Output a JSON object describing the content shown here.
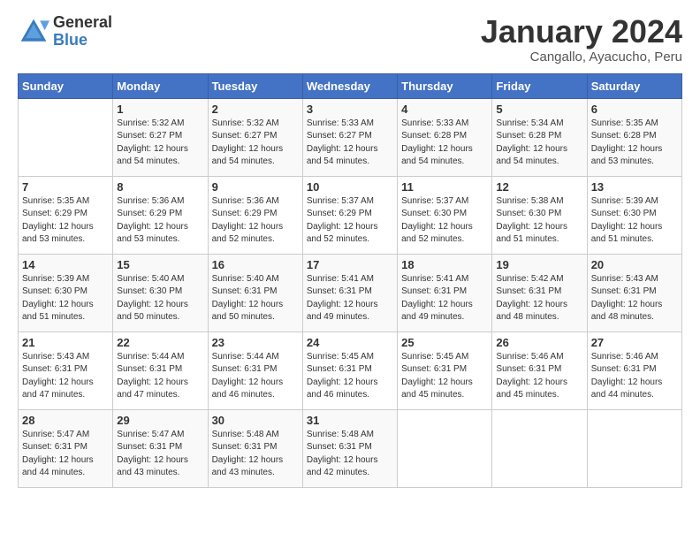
{
  "header": {
    "logo_general": "General",
    "logo_blue": "Blue",
    "month_title": "January 2024",
    "subtitle": "Cangallo, Ayacucho, Peru"
  },
  "days_of_week": [
    "Sunday",
    "Monday",
    "Tuesday",
    "Wednesday",
    "Thursday",
    "Friday",
    "Saturday"
  ],
  "weeks": [
    [
      {
        "day": "",
        "info": ""
      },
      {
        "day": "1",
        "info": "Sunrise: 5:32 AM\nSunset: 6:27 PM\nDaylight: 12 hours\nand 54 minutes."
      },
      {
        "day": "2",
        "info": "Sunrise: 5:32 AM\nSunset: 6:27 PM\nDaylight: 12 hours\nand 54 minutes."
      },
      {
        "day": "3",
        "info": "Sunrise: 5:33 AM\nSunset: 6:27 PM\nDaylight: 12 hours\nand 54 minutes."
      },
      {
        "day": "4",
        "info": "Sunrise: 5:33 AM\nSunset: 6:28 PM\nDaylight: 12 hours\nand 54 minutes."
      },
      {
        "day": "5",
        "info": "Sunrise: 5:34 AM\nSunset: 6:28 PM\nDaylight: 12 hours\nand 54 minutes."
      },
      {
        "day": "6",
        "info": "Sunrise: 5:35 AM\nSunset: 6:28 PM\nDaylight: 12 hours\nand 53 minutes."
      }
    ],
    [
      {
        "day": "7",
        "info": "Sunrise: 5:35 AM\nSunset: 6:29 PM\nDaylight: 12 hours\nand 53 minutes."
      },
      {
        "day": "8",
        "info": "Sunrise: 5:36 AM\nSunset: 6:29 PM\nDaylight: 12 hours\nand 53 minutes."
      },
      {
        "day": "9",
        "info": "Sunrise: 5:36 AM\nSunset: 6:29 PM\nDaylight: 12 hours\nand 52 minutes."
      },
      {
        "day": "10",
        "info": "Sunrise: 5:37 AM\nSunset: 6:29 PM\nDaylight: 12 hours\nand 52 minutes."
      },
      {
        "day": "11",
        "info": "Sunrise: 5:37 AM\nSunset: 6:30 PM\nDaylight: 12 hours\nand 52 minutes."
      },
      {
        "day": "12",
        "info": "Sunrise: 5:38 AM\nSunset: 6:30 PM\nDaylight: 12 hours\nand 51 minutes."
      },
      {
        "day": "13",
        "info": "Sunrise: 5:39 AM\nSunset: 6:30 PM\nDaylight: 12 hours\nand 51 minutes."
      }
    ],
    [
      {
        "day": "14",
        "info": "Sunrise: 5:39 AM\nSunset: 6:30 PM\nDaylight: 12 hours\nand 51 minutes."
      },
      {
        "day": "15",
        "info": "Sunrise: 5:40 AM\nSunset: 6:30 PM\nDaylight: 12 hours\nand 50 minutes."
      },
      {
        "day": "16",
        "info": "Sunrise: 5:40 AM\nSunset: 6:31 PM\nDaylight: 12 hours\nand 50 minutes."
      },
      {
        "day": "17",
        "info": "Sunrise: 5:41 AM\nSunset: 6:31 PM\nDaylight: 12 hours\nand 49 minutes."
      },
      {
        "day": "18",
        "info": "Sunrise: 5:41 AM\nSunset: 6:31 PM\nDaylight: 12 hours\nand 49 minutes."
      },
      {
        "day": "19",
        "info": "Sunrise: 5:42 AM\nSunset: 6:31 PM\nDaylight: 12 hours\nand 48 minutes."
      },
      {
        "day": "20",
        "info": "Sunrise: 5:43 AM\nSunset: 6:31 PM\nDaylight: 12 hours\nand 48 minutes."
      }
    ],
    [
      {
        "day": "21",
        "info": "Sunrise: 5:43 AM\nSunset: 6:31 PM\nDaylight: 12 hours\nand 47 minutes."
      },
      {
        "day": "22",
        "info": "Sunrise: 5:44 AM\nSunset: 6:31 PM\nDaylight: 12 hours\nand 47 minutes."
      },
      {
        "day": "23",
        "info": "Sunrise: 5:44 AM\nSunset: 6:31 PM\nDaylight: 12 hours\nand 46 minutes."
      },
      {
        "day": "24",
        "info": "Sunrise: 5:45 AM\nSunset: 6:31 PM\nDaylight: 12 hours\nand 46 minutes."
      },
      {
        "day": "25",
        "info": "Sunrise: 5:45 AM\nSunset: 6:31 PM\nDaylight: 12 hours\nand 45 minutes."
      },
      {
        "day": "26",
        "info": "Sunrise: 5:46 AM\nSunset: 6:31 PM\nDaylight: 12 hours\nand 45 minutes."
      },
      {
        "day": "27",
        "info": "Sunrise: 5:46 AM\nSunset: 6:31 PM\nDaylight: 12 hours\nand 44 minutes."
      }
    ],
    [
      {
        "day": "28",
        "info": "Sunrise: 5:47 AM\nSunset: 6:31 PM\nDaylight: 12 hours\nand 44 minutes."
      },
      {
        "day": "29",
        "info": "Sunrise: 5:47 AM\nSunset: 6:31 PM\nDaylight: 12 hours\nand 43 minutes."
      },
      {
        "day": "30",
        "info": "Sunrise: 5:48 AM\nSunset: 6:31 PM\nDaylight: 12 hours\nand 43 minutes."
      },
      {
        "day": "31",
        "info": "Sunrise: 5:48 AM\nSunset: 6:31 PM\nDaylight: 12 hours\nand 42 minutes."
      },
      {
        "day": "",
        "info": ""
      },
      {
        "day": "",
        "info": ""
      },
      {
        "day": "",
        "info": ""
      }
    ]
  ]
}
